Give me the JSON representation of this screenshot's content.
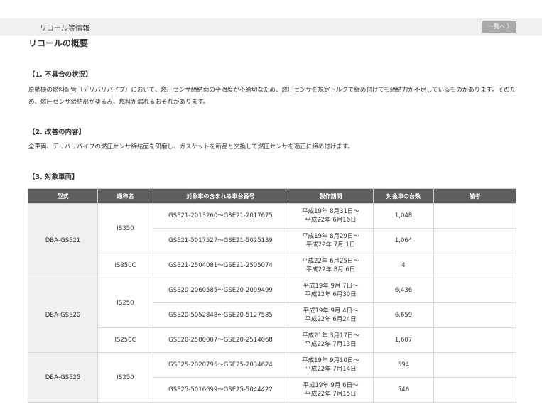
{
  "header": {
    "title": "リコール等情報",
    "back_button": "一覧へ",
    "back_chevron": "〉"
  },
  "page_title": "リコールの概要",
  "sections": [
    {
      "heading": "【1. 不具合の状況】",
      "text": "原動機の燃料配管（デリバリパイプ）において、燃圧センサ締結面の平滑度が不適切なため、燃圧センサを規定トルクで締め付けても締結力が不足しているものがあります。そのため、燃圧センサ締結部がゆるみ、燃料が漏れるおそれがあります。"
    },
    {
      "heading": "【2. 改善の内容】",
      "text": "全車両、デリバリパイプの燃圧センサ締結面を研磨し、ガスケットを新品と交換して燃圧センサを適正に締め付けます。"
    },
    {
      "heading": "【3. 対象車両】",
      "text": ""
    }
  ],
  "table": {
    "headers": [
      "型式",
      "通称名",
      "対象車の含まれる車台番号",
      "製作期間",
      "対象車の台数",
      "備考"
    ],
    "groups": [
      {
        "model": "DBA-GSE21",
        "names": [
          {
            "name": "IS350",
            "rows": [
              {
                "vin": "GSE21-2013260～GSE21-2017675",
                "p1": "平成19年 8月31日～",
                "p2": "平成22年 6月16日",
                "count": "1,048"
              },
              {
                "vin": "GSE21-5017527～GSE21-5025139",
                "p1": "平成19年 8月29日～",
                "p2": "平成22年 7月 1日",
                "count": "1,064"
              }
            ]
          },
          {
            "name": "IS350C",
            "rows": [
              {
                "vin": "GSE21-2504081～GSE21-2505074",
                "p1": "平成22年 6月25日～",
                "p2": "平成22年 8月 6日",
                "count": "4"
              }
            ]
          }
        ]
      },
      {
        "model": "DBA-GSE20",
        "names": [
          {
            "name": "IS250",
            "rows": [
              {
                "vin": "GSE20-2060585～GSE20-2099499",
                "p1": "平成19年 9月 7日～",
                "p2": "平成22年 6月30日",
                "count": "6,436"
              },
              {
                "vin": "GSE20-5052848～GSE20-5127585",
                "p1": "平成19年 9月 4日～",
                "p2": "平成22年 6月24日",
                "count": "6,659"
              }
            ]
          },
          {
            "name": "IS250C",
            "rows": [
              {
                "vin": "GSE20-2500007～GSE20-2514068",
                "p1": "平成21年 3月17日～",
                "p2": "平成22年 7月13日",
                "count": "1,607"
              }
            ]
          }
        ]
      },
      {
        "model": "DBA-GSE25",
        "names": [
          {
            "name": "IS250",
            "rows": [
              {
                "vin": "GSE25-2020795～GSE25-2034624",
                "p1": "平成19年 9月10日～",
                "p2": "平成22年 7月14日",
                "count": "594"
              },
              {
                "vin": "GSE25-5016699～GSE25-5044422",
                "p1": "平成19年 9月 6日～",
                "p2": "平成22年 7月15日",
                "count": "546"
              }
            ]
          }
        ]
      }
    ]
  }
}
